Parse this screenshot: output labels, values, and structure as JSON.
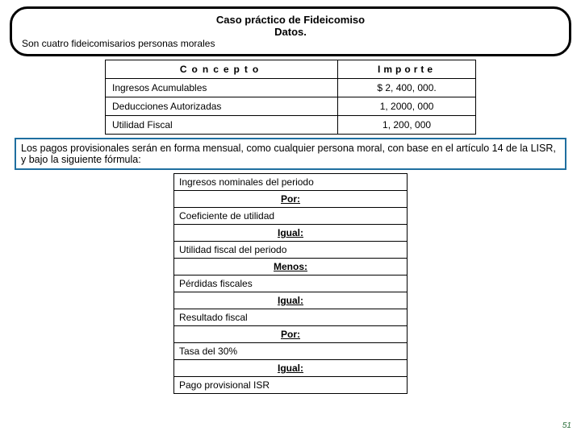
{
  "header": {
    "title": "Caso práctico de Fideicomiso",
    "subtitle": "Datos.",
    "note": "Son cuatro fideicomisarios personas morales"
  },
  "table": {
    "head_concepto": "Concepto",
    "head_importe": "Importe",
    "rows": [
      {
        "concepto": "Ingresos Acumulables",
        "importe": "$  2, 400, 000."
      },
      {
        "concepto": "Deducciones Autorizadas",
        "importe": "1, 2000, 000"
      },
      {
        "concepto": "Utilidad Fiscal",
        "importe": "1, 200, 000"
      }
    ]
  },
  "paragraph": "Los pagos provisionales serán en forma mensual, como cualquier persona moral, con base en el artículo 14 de la LISR, y bajo la siguiente fórmula:",
  "formula": [
    {
      "text": "Ingresos nominales del periodo",
      "op": false
    },
    {
      "text": "Por:",
      "op": true
    },
    {
      "text": "Coeficiente de utilidad",
      "op": false
    },
    {
      "text": "Igual:",
      "op": true
    },
    {
      "text": "Utilidad fiscal del periodo",
      "op": false
    },
    {
      "text": "Menos:",
      "op": true
    },
    {
      "text": "Pérdidas fiscales",
      "op": false
    },
    {
      "text": "Igual:",
      "op": true
    },
    {
      "text": "Resultado fiscal",
      "op": false
    },
    {
      "text": "Por:",
      "op": true
    },
    {
      "text": "Tasa del 30%",
      "op": false
    },
    {
      "text": "Igual:",
      "op": true
    },
    {
      "text": "Pago provisional ISR",
      "op": false
    }
  ],
  "page_number": "51",
  "chart_data": {
    "type": "table",
    "title": "Caso práctico de Fideicomiso — Datos",
    "columns": [
      "Concepto",
      "Importe"
    ],
    "rows": [
      [
        "Ingresos Acumulables",
        2400000
      ],
      [
        "Deducciones Autorizadas",
        1200000
      ],
      [
        "Utilidad Fiscal",
        1200000
      ]
    ]
  }
}
